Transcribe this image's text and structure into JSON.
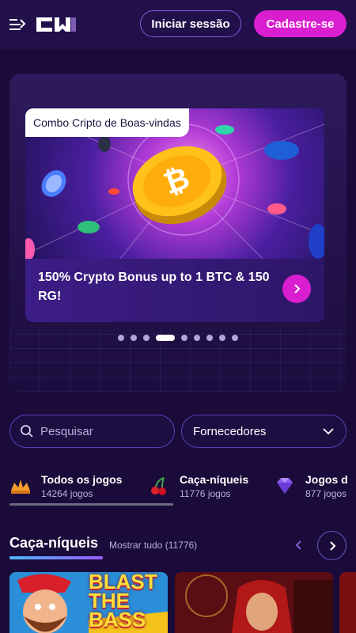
{
  "header": {
    "login_label": "Iniciar sessão",
    "signup_label": "Cadastre-se"
  },
  "hero": {
    "tag": "Combo Cripto de Boas-vindas",
    "title": "150% Crypto Bonus up to 1 BTC & 150 RG!",
    "slides_total": 9,
    "slide_active": 4
  },
  "search": {
    "placeholder": "Pesquisar"
  },
  "providers": {
    "label": "Fornecedores"
  },
  "categories": [
    {
      "name": "Todos os jogos",
      "count": "14264 jogos",
      "icon": "crown-icon"
    },
    {
      "name": "Caça-níqueis",
      "count": "11776 jogos",
      "icon": "cherry-icon"
    },
    {
      "name": "Jogos d",
      "count": "877 jogos",
      "icon": "diamond-icon"
    }
  ],
  "section": {
    "title": "Caça-níqueis",
    "show_all": "Mostrar tudo (11776)"
  },
  "games": [
    {
      "title": "BLAST THE BASS"
    }
  ],
  "colors": {
    "accent": "#d91ed0",
    "background": "#1a0b3a",
    "header": "#21104a"
  }
}
